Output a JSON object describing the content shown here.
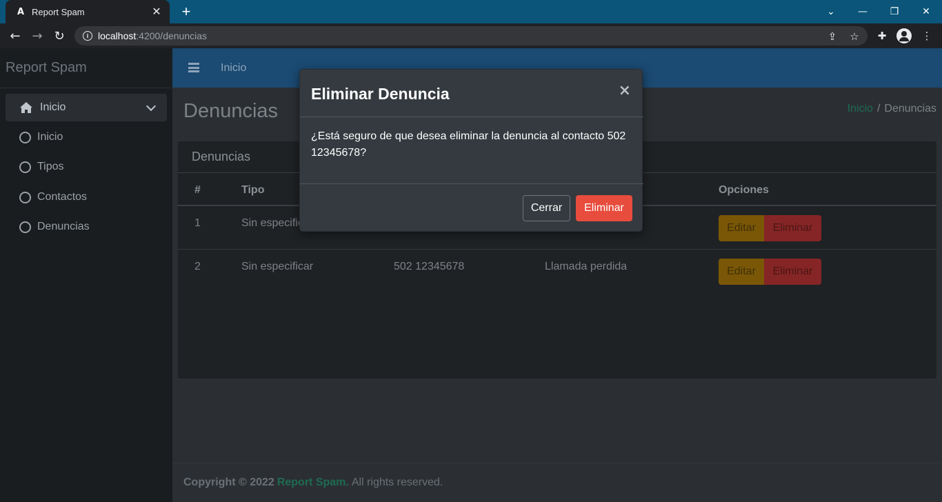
{
  "browser": {
    "tab_title": "Report Spam",
    "tab_logo": "A",
    "url_host": "localhost",
    "url_path": ":4200/denuncias"
  },
  "sidebar": {
    "brand": "Report Spam",
    "main_item": "Inicio",
    "items": [
      {
        "label": "Inicio"
      },
      {
        "label": "Tipos"
      },
      {
        "label": "Contactos"
      },
      {
        "label": "Denuncias"
      }
    ]
  },
  "topnav": {
    "link": "Inicio"
  },
  "page": {
    "title": "Denuncias",
    "breadcrumb": {
      "home": "Inicio",
      "separator": "/",
      "current": "Denuncias"
    }
  },
  "card": {
    "title": "Denuncias",
    "columns": [
      "#",
      "Tipo",
      "Opciones"
    ],
    "rows": [
      {
        "num": "1",
        "tipo": "Sin especificar",
        "contacto": "",
        "descripcion": ""
      },
      {
        "num": "2",
        "tipo": "Sin especificar",
        "contacto": "502 12345678",
        "descripcion": "Llamada perdida"
      }
    ],
    "edit_label": "Editar",
    "delete_label": "Eliminar"
  },
  "footer": {
    "copyright": "Copyright © 2022",
    "brand": "Report Spam.",
    "rights": "All rights reserved."
  },
  "modal": {
    "title": "Eliminar Denuncia",
    "close": "×",
    "body": "¿Está seguro de que desea eliminar la denuncia al contacto 502 12345678?",
    "cancel_label": "Cerrar",
    "confirm_label": "Eliminar"
  },
  "colors": {
    "sidebar_bg": "#1a1d20",
    "topnav_bg": "#1b4a72",
    "modal_bg": "#343a40",
    "danger": "#e74c3c",
    "warning": "#7a5707",
    "brand_green": "#1e6b52"
  }
}
